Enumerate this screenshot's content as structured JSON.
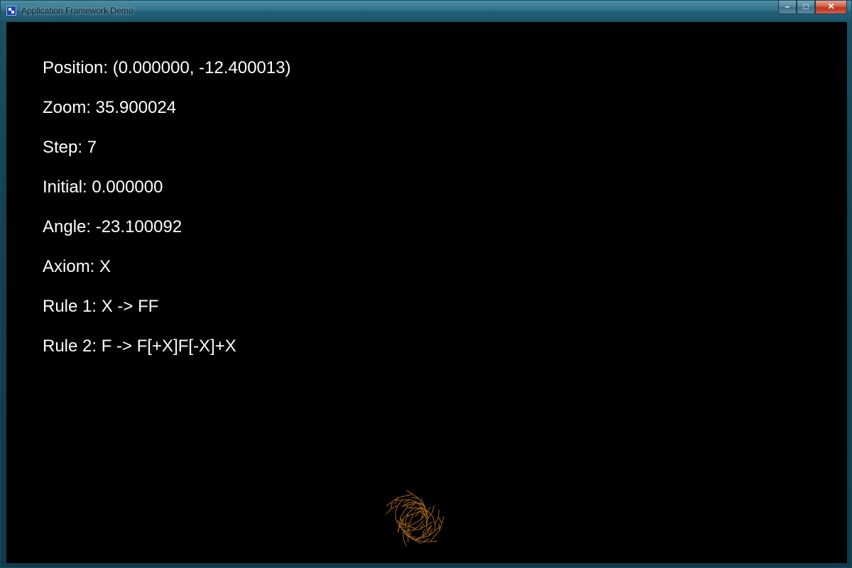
{
  "window": {
    "title": "Application Framework Demo",
    "controls": {
      "minimize": "–",
      "maximize": "□",
      "close": "✕"
    }
  },
  "info": {
    "position": "Position: (0.000000, -12.400013)",
    "zoom": "Zoom: 35.900024",
    "step": "Step: 7",
    "initial": "Initial: 0.000000",
    "angle": "Angle: -23.100092",
    "axiom": "Axiom: X",
    "rule1": "Rule 1: X -> FF",
    "rule2": "Rule 2: F -> F[+X]F[-X]+X"
  },
  "lsystem": {
    "axiom": "X",
    "rules": {
      "X": "FF",
      "F": "F[+X]F[-X]+X"
    },
    "angle_deg": -23.100092,
    "initial_deg": 0,
    "step": 7,
    "stroke_color": "#a0621c"
  },
  "colors": {
    "background": "#000000",
    "text": "#ffffff"
  }
}
